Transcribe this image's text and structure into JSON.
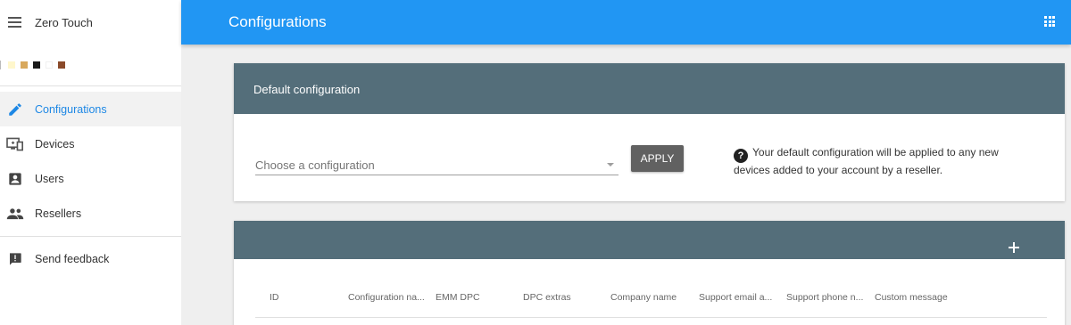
{
  "sidebar": {
    "app_title": "Zero Touch",
    "swatches": [
      "#fff7cc",
      "#d8a85c",
      "#1a1a1a",
      "#ffffff",
      "#8a4a2a"
    ],
    "items": [
      {
        "label": "Configurations",
        "icon": "pencil-icon",
        "active": true
      },
      {
        "label": "Devices",
        "icon": "devices-icon",
        "active": false
      },
      {
        "label": "Users",
        "icon": "user-icon",
        "active": false
      },
      {
        "label": "Resellers",
        "icon": "people-icon",
        "active": false
      }
    ],
    "feedback": {
      "label": "Send feedback",
      "icon": "feedback-icon"
    }
  },
  "topbar": {
    "title": "Configurations",
    "apps_icon": "apps-grid-icon",
    "color": "#2196f3"
  },
  "default_config": {
    "title": "Default configuration",
    "select_placeholder": "Choose a configuration",
    "apply_label": "APPLY",
    "help_text": "Your default configuration will be applied to any new devices added to your account by a reseller."
  },
  "configs_table": {
    "add_icon": "add-icon",
    "columns": [
      "ID",
      "Configuration na...",
      "EMM DPC",
      "DPC extras",
      "Company name",
      "Support email a...",
      "Support phone n...",
      "Custom message"
    ]
  },
  "colors": {
    "accent": "#1e88e5",
    "card_header": "#546e7a",
    "button": "#616161"
  }
}
